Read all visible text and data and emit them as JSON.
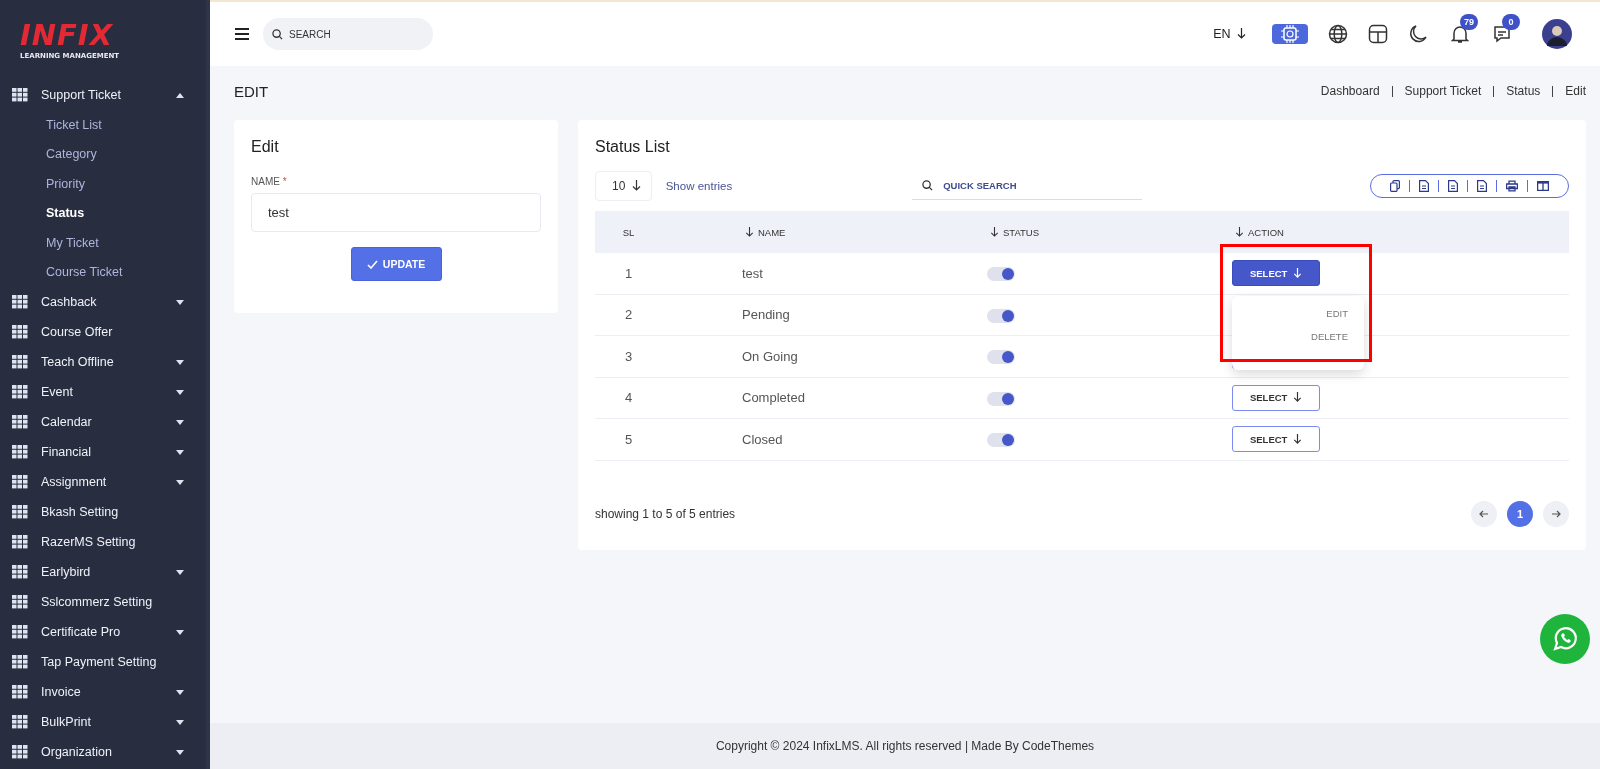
{
  "logo": {
    "brand": "INFIX",
    "tagline": "LEARNING MANAGEMENT"
  },
  "sidebar": {
    "items": [
      {
        "label": "Support Ticket",
        "kind": "group",
        "expanded": true,
        "children": [
          {
            "label": "Ticket List",
            "selected": false
          },
          {
            "label": "Category",
            "selected": false
          },
          {
            "label": "Priority",
            "selected": false
          },
          {
            "label": "Status",
            "selected": true
          },
          {
            "label": "My Ticket",
            "selected": false
          },
          {
            "label": "Course Ticket",
            "selected": false
          }
        ]
      },
      {
        "label": "Cashback",
        "kind": "group",
        "expanded": false
      },
      {
        "label": "Course Offer",
        "kind": "link"
      },
      {
        "label": "Teach Offline",
        "kind": "group",
        "expanded": false
      },
      {
        "label": "Event",
        "kind": "group",
        "expanded": false
      },
      {
        "label": "Calendar",
        "kind": "group",
        "expanded": false
      },
      {
        "label": "Financial",
        "kind": "group",
        "expanded": false
      },
      {
        "label": "Assignment",
        "kind": "group",
        "expanded": false
      },
      {
        "label": "Bkash Setting",
        "kind": "link"
      },
      {
        "label": "RazerMS Setting",
        "kind": "link"
      },
      {
        "label": "Earlybird",
        "kind": "group",
        "expanded": false
      },
      {
        "label": "Sslcommerz Setting",
        "kind": "link"
      },
      {
        "label": "Certificate Pro",
        "kind": "group",
        "expanded": false
      },
      {
        "label": "Tap Payment Setting",
        "kind": "link"
      },
      {
        "label": "Invoice",
        "kind": "group",
        "expanded": false
      },
      {
        "label": "BulkPrint",
        "kind": "group",
        "expanded": false
      },
      {
        "label": "Organization",
        "kind": "group",
        "expanded": false
      }
    ]
  },
  "header": {
    "search_placeholder": "SEARCH",
    "language": "EN",
    "notifications": "79",
    "messages": "0"
  },
  "page_title": "EDIT",
  "breadcrumbs": [
    "Dashboard",
    "Support Ticket",
    "Status",
    "Edit"
  ],
  "edit_form": {
    "title": "Edit",
    "name_label": "NAME",
    "required_mark": "*",
    "name_value": "test",
    "button": "UPDATE"
  },
  "status_list": {
    "title": "Status List",
    "page_size": "10",
    "show_entries": "Show entries",
    "search_placeholder": "QUICK SEARCH",
    "columns": [
      "SL",
      "NAME",
      "STATUS",
      "ACTION"
    ],
    "rows": [
      {
        "sl": "1",
        "name": "test",
        "on": true,
        "action": "SELECT",
        "menu_open": true
      },
      {
        "sl": "2",
        "name": "Pending",
        "on": true
      },
      {
        "sl": "3",
        "name": "On Going",
        "on": true,
        "button_text_covered": true,
        "menu_open": false
      },
      {
        "sl": "4",
        "name": "Completed",
        "on": true,
        "action": "SELECT",
        "menu_open": false
      },
      {
        "sl": "5",
        "name": "Closed",
        "on": true,
        "action": "SELECT",
        "menu_open": false
      }
    ],
    "menu": {
      "items": [
        "EDIT",
        "DELETE"
      ],
      "highlighted": true
    },
    "summary": "showing 1 to 5 of 5 entries",
    "pages": [
      {
        "label": "1",
        "selected": true
      }
    ]
  },
  "copyright": "Copyright © 2024 InfixLMS. All rights reserved | Made By CodeThemes"
}
